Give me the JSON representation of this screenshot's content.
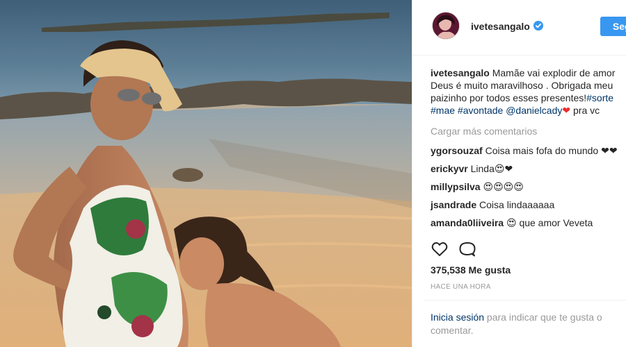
{
  "photo": {
    "alt_icon": "beach-photo"
  },
  "header": {
    "username": "ivetesangalo",
    "verified_icon": "verified-badge-icon",
    "follow_label": "Segu"
  },
  "caption": {
    "user": "ivetesangalo",
    "line1": "Mamãe vai explodir de amor",
    "line2": "Deus é muito maravilhoso . Obrigada meu",
    "line3_text": "paizinho por todos esses presentes!",
    "line3_tag": "#sorte",
    "line4_tag1": "#mae",
    "line4_tag2": "#avontade",
    "line4_mention": "@danielcady",
    "line4_heart": "❤",
    "line4_end": "pra vc"
  },
  "load_more": "Cargar más comentarios",
  "comments": [
    {
      "user": "ygorsouzaf",
      "text": "Coisa mais fofa do mundo ❤❤"
    },
    {
      "user": "erickyvr",
      "text": "Linda😍❤"
    },
    {
      "user": "millypsilva",
      "text": "😍😍😍😍"
    },
    {
      "user": "jsandrade",
      "text": "Coisa lindaaaaaa"
    },
    {
      "user": "amanda0liiveira",
      "text": "😍 que amor Veveta"
    }
  ],
  "actions": {
    "like_icon": "heart-outline-icon",
    "comment_icon": "comment-bubble-icon"
  },
  "likes": "375,538 Me gusta",
  "time": "HACE UNA HORA",
  "login": {
    "link": "Inicia sesión",
    "text": " para indicar que te gusta o comentar."
  },
  "colors": {
    "accent": "#3897f0",
    "link": "#003569",
    "muted": "#999999",
    "heart": "#ed2a2a"
  }
}
